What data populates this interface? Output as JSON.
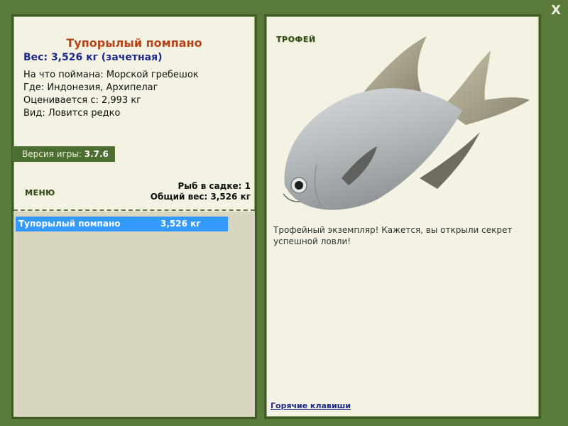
{
  "window": {
    "close_label": "X"
  },
  "fish": {
    "title": "Тупорылый помпано",
    "weight_line": "Вес: 3,526 кг (зачетная)",
    "caught_on": "На что поймана: Морской гребешок",
    "where": "Где: Индонезия, Архипелаг",
    "rated_from": "Оценивается с: 2,993 кг",
    "kind": "Вид: Ловится редко"
  },
  "version": {
    "label": "Версия игры: ",
    "value": "3.7.6"
  },
  "menu": {
    "label": "МЕНЮ"
  },
  "cage": {
    "count_line": "Рыб в садке: 1",
    "total_line": "Общий вес: 3,526 кг"
  },
  "catch_list": [
    {
      "name": "Тупорылый помпано",
      "weight": "3,526 кг"
    }
  ],
  "trophy": {
    "label": "ТРОФЕЙ",
    "description": "Трофейный экземпляр! Кажется, вы открыли секрет успешной ловли!"
  },
  "footer": {
    "hotkeys_label": "Горячие клавиши"
  },
  "colors": {
    "background": "#5a7a3a",
    "panel": "#f4f2e2",
    "title": "#b7441a",
    "weight": "#1b2a8a",
    "selection": "#3399ff"
  }
}
